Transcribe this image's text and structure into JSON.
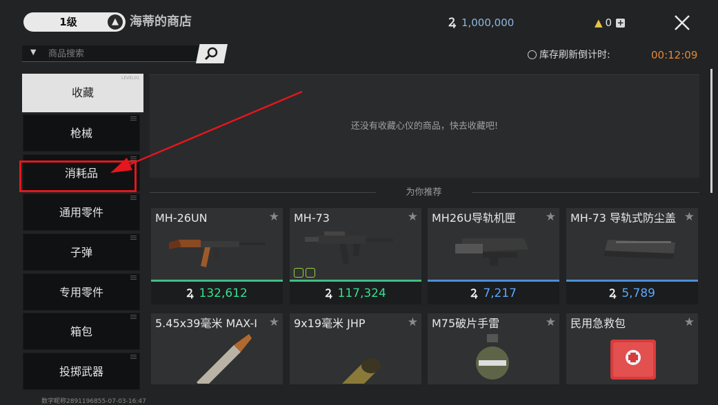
{
  "header": {
    "level": "1级",
    "shop_title": "海蒂的商店",
    "currency_amount": "1,000,000",
    "gold_amount": "0"
  },
  "search": {
    "placeholder": "商品搜索"
  },
  "refresh": {
    "label": "库存刷新倒计时:",
    "timer": "00:12:09"
  },
  "sidebar": {
    "active_tag": "LEVEL01",
    "items": [
      {
        "label": "收藏"
      },
      {
        "label": "枪械"
      },
      {
        "label": "消耗品"
      },
      {
        "label": "通用零件"
      },
      {
        "label": "子弹"
      },
      {
        "label": "专用零件"
      },
      {
        "label": "箱包"
      },
      {
        "label": "投掷武器"
      }
    ]
  },
  "favorites": {
    "empty_text": "还没有收藏心仪的商品，快去收藏吧!"
  },
  "recommend": {
    "title": "为你推荐",
    "items": [
      {
        "name": "MH-26UN",
        "price": "132,612",
        "price_color": "#35e08f",
        "bar_color": "#3fbf86",
        "icon": "rifle-icon"
      },
      {
        "name": "MH-73",
        "price": "117,324",
        "price_color": "#35e08f",
        "bar_color": "#3fbf86",
        "icon": "smg-icon"
      },
      {
        "name": "MH26U导轨机匣",
        "price": "7,217",
        "price_color": "#5aa8ff",
        "bar_color": "#4d8fd6",
        "icon": "receiver-icon"
      },
      {
        "name": "MH-73 导轨式防尘盖",
        "price": "5,789",
        "price_color": "#5aa8ff",
        "bar_color": "#4d8fd6",
        "icon": "dust-cover-icon"
      },
      {
        "name": "5.45x39毫米 MAX-I",
        "icon": "rifle-cartridge-icon"
      },
      {
        "name": "9x19毫米 JHP",
        "icon": "pistol-cartridge-icon"
      },
      {
        "name": "M75破片手雷",
        "icon": "grenade-icon"
      },
      {
        "name": "民用急救包",
        "icon": "first-aid-kit-icon"
      }
    ]
  },
  "footer": {
    "text": "数字昵称2891196855-07-03-16:47"
  }
}
